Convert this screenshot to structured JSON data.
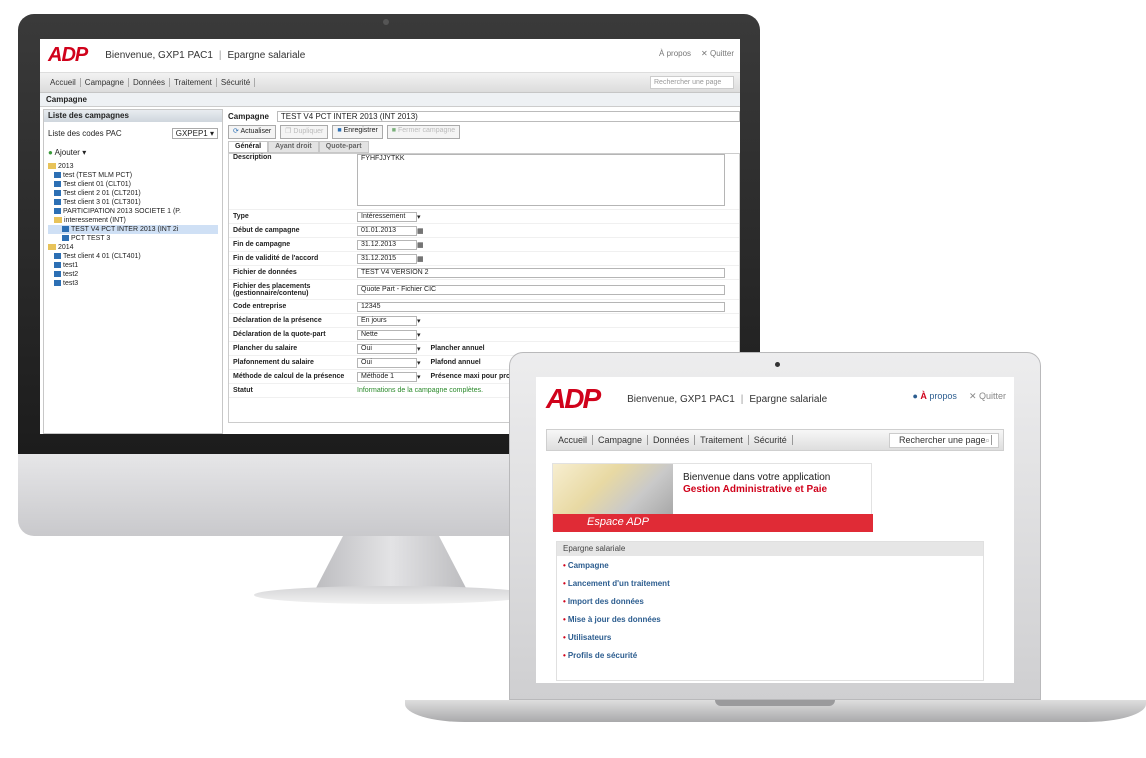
{
  "desktop": {
    "logo": "ADP",
    "welcome": "Bienvenue, GXP1 PAC1",
    "module": "Epargne salariale",
    "about": "À propos",
    "quit": "Quitter",
    "nav": [
      "Accueil",
      "Campagne",
      "Données",
      "Traitement",
      "Sécurité"
    ],
    "search_placeholder": "Rechercher une page",
    "page_title": "Campagne",
    "left_panel": {
      "title": "Liste des campagnes",
      "pac_label": "Liste des codes PAC",
      "pac_value": "GXPEP1",
      "add_label": "Ajouter ▾",
      "tree": [
        {
          "label": "2013",
          "type": "folder",
          "level": 0
        },
        {
          "label": "test (TEST MLM PCT)",
          "type": "item",
          "level": 1
        },
        {
          "label": "Test client 01 (CLT01)",
          "type": "item",
          "level": 1
        },
        {
          "label": "Test client 2 01 (CLT201)",
          "type": "item",
          "level": 1
        },
        {
          "label": "Test client 3 01 (CLT301)",
          "type": "item",
          "level": 1
        },
        {
          "label": "PARTICIPATION 2013 SOCIETE 1 (P.",
          "type": "item",
          "level": 1
        },
        {
          "label": "interessement (INT)",
          "type": "folder",
          "level": 1
        },
        {
          "label": "TEST V4 PCT INTER 2013 (INT 2i",
          "type": "item",
          "level": 2,
          "selected": true
        },
        {
          "label": "PCT TEST 3",
          "type": "item",
          "level": 2
        },
        {
          "label": "2014",
          "type": "folder",
          "level": 0
        },
        {
          "label": "Test client 4 01 (CLT401)",
          "type": "item",
          "level": 1
        },
        {
          "label": "test1",
          "type": "item",
          "level": 1
        },
        {
          "label": "test2",
          "type": "item",
          "level": 1
        },
        {
          "label": "test3",
          "type": "item",
          "level": 1
        }
      ]
    },
    "form": {
      "campaign_label": "Campagne",
      "campaign_value": "TEST V4 PCT INTER 2013 (INT 2013)",
      "toolbar": {
        "refresh": "Actualiser",
        "duplicate": "Dupliquer",
        "save": "Enregistrer",
        "close": "Fermer campagne"
      },
      "tabs": [
        "Général",
        "Ayant droit",
        "Quote-part"
      ],
      "description_label": "Description",
      "description_value": "FYHFJJYTKK",
      "type_label": "Type",
      "type_value": "Intéressement",
      "start_label": "Début de campagne",
      "start_value": "01.01.2013",
      "end_label": "Fin de campagne",
      "end_value": "31.12.2013",
      "validity_label": "Fin de validité de l'accord",
      "validity_value": "31.12.2015",
      "data_file_label": "Fichier de données",
      "data_file_value": "TEST V4 VERSION 2",
      "placement_label": "Fichier des placements (gestionnaire/contenu)",
      "placement_value": "Quote Part - Fichier CIC",
      "company_label": "Code entreprise",
      "company_value": "12345",
      "presence_label": "Déclaration de la présence",
      "presence_value": "En jours",
      "quota_label": "Déclaration de la quote-part",
      "quota_value": "Nette",
      "floor_label": "Plancher du salaire",
      "floor_value": "Oui",
      "floor_annual_label": "Plancher annuel",
      "cap_label": "Plafonnement du salaire",
      "cap_value": "Oui",
      "cap_annual_label": "Plafond annuel",
      "method_label": "Méthode de calcul de la présence",
      "method_value": "Méthode 1",
      "presence_max_label": "Présence maxi pour prorata",
      "status_label": "Statut",
      "status_value": "Informations de la campagne complètes."
    }
  },
  "laptop": {
    "logo": "ADP",
    "welcome": "Bienvenue, GXP1 PAC1",
    "module": "Epargne salariale",
    "about_a": "À",
    "about_b": "propos",
    "quit": "Quitter",
    "nav": [
      "Accueil",
      "Campagne",
      "Données",
      "Traitement",
      "Sécurité"
    ],
    "search_placeholder": "Rechercher une page",
    "banner": {
      "line1": "Bienvenue dans votre application",
      "line2": "Gestion Administrative et Paie",
      "strip": "Espace ADP"
    },
    "menu_title": "Epargne salariale",
    "menu": [
      "Campagne",
      "Lancement d'un traitement",
      "Import des données",
      "Mise à jour des données",
      "Utilisateurs",
      "Profils de sécurité"
    ]
  },
  "colors": {
    "brand_red": "#d0021b",
    "link_blue": "#2c5d8f",
    "status_green": "#2b8a2b"
  }
}
